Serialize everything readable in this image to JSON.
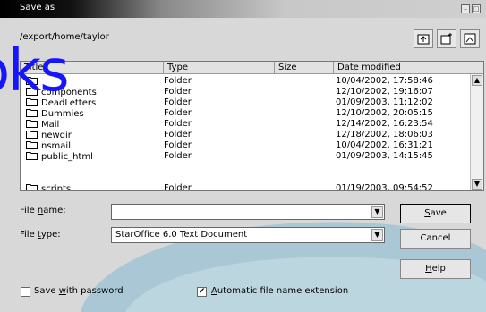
{
  "window": {
    "title": "Save as"
  },
  "path": "/export/home/taylor",
  "toolbar": {
    "icons": [
      "folder-up-icon",
      "new-folder-icon",
      "default-folder-icon"
    ]
  },
  "columns": {
    "title": "Title",
    "type": "Type",
    "size": "Size",
    "date": "Date modified"
  },
  "files": [
    {
      "name": "",
      "type": "Folder",
      "date": "10/04/2002, 17:58:46"
    },
    {
      "name": "components",
      "type": "Folder",
      "date": "12/10/2002, 19:16:07"
    },
    {
      "name": "DeadLetters",
      "type": "Folder",
      "date": "01/09/2003, 11:12:02"
    },
    {
      "name": "Dummies",
      "type": "Folder",
      "date": "12/10/2002, 20:05:15"
    },
    {
      "name": "Mail",
      "type": "Folder",
      "date": "12/14/2002, 16:23:54"
    },
    {
      "name": "newdir",
      "type": "Folder",
      "date": "12/18/2002, 18:06:03"
    },
    {
      "name": "nsmail",
      "type": "Folder",
      "date": "10/04/2002, 16:31:21"
    },
    {
      "name": "public_html",
      "type": "Folder",
      "date": "01/09/2003, 14:15:45"
    },
    {
      "name": "scripts",
      "type": "Folder",
      "date": "01/19/2003, 09:54:52"
    }
  ],
  "file_name": {
    "label_pre": "File ",
    "label_u": "n",
    "label_post": "ame:",
    "value": ""
  },
  "file_type": {
    "label_pre": "File ",
    "label_u": "t",
    "label_post": "ype:",
    "value": "StarOffice 6.0 Text Document"
  },
  "buttons": {
    "save_u": "S",
    "save_rest": "ave",
    "cancel": "Cancel",
    "help_u": "H",
    "help_rest": "elp"
  },
  "options": {
    "save_password": {
      "pre": "Save ",
      "u": "w",
      "post": "ith password",
      "checked": false
    },
    "auto_ext": {
      "pre": "",
      "u": "A",
      "post": "utomatic file name extension",
      "checked": true
    }
  },
  "overlay": {
    "text": "oks",
    "color": "#1515ff"
  },
  "colors": {
    "window_bg": "#d8d8d8",
    "accent_wave": "#a9c7d4"
  }
}
